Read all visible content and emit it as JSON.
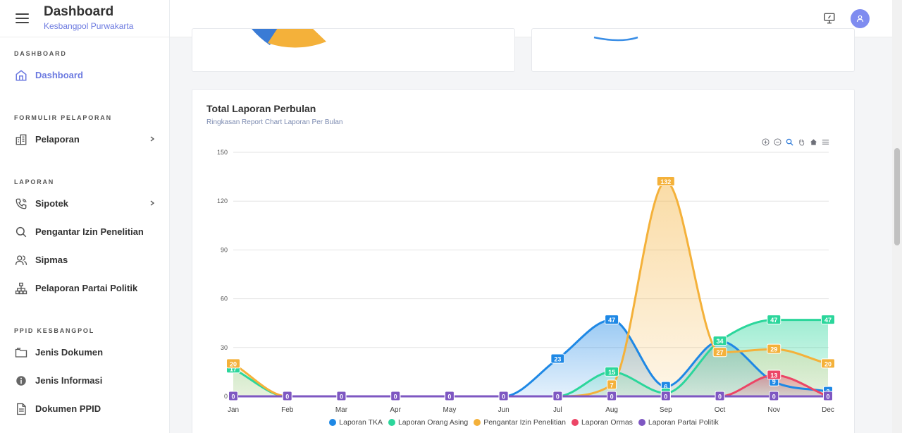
{
  "header": {
    "title": "Dashboard",
    "subtitle": "Kesbangpol Purwakarta"
  },
  "sidebar": {
    "sections": [
      {
        "title": "DASHBOARD",
        "items": [
          {
            "label": "Dashboard",
            "icon": "home-icon",
            "active": true
          }
        ]
      },
      {
        "title": "FORMULIR PELAPORAN",
        "items": [
          {
            "label": "Pelaporan",
            "icon": "building-icon",
            "chevron": true
          }
        ]
      },
      {
        "title": "LAPORAN",
        "items": [
          {
            "label": "Sipotek",
            "icon": "phone-icon",
            "chevron": true
          },
          {
            "label": "Pengantar Izin Penelitian",
            "icon": "search-icon"
          },
          {
            "label": "Sipmas",
            "icon": "users-icon"
          },
          {
            "label": "Pelaporan Partai Politik",
            "icon": "sitemap-icon"
          }
        ]
      },
      {
        "title": "PPID KESBANGPOL",
        "items": [
          {
            "label": "Jenis Dokumen",
            "icon": "folder-icon"
          },
          {
            "label": "Jenis Informasi",
            "icon": "info-icon"
          },
          {
            "label": "Dokumen PPID",
            "icon": "document-icon"
          }
        ]
      }
    ]
  },
  "colors": {
    "accent": "#6c7ae0",
    "tka": "#1E88E5",
    "asing": "#2BD69B",
    "izin": "#F4B13A",
    "ormas": "#EC4566",
    "partai": "#7E57C2"
  },
  "chart_data": {
    "type": "area",
    "title": "Total Laporan Perbulan",
    "subtitle": "Ringkasan Report Chart Laporan Per Bulan",
    "categories": [
      "Jan",
      "Feb",
      "Mar",
      "Apr",
      "May",
      "Jun",
      "Jul",
      "Aug",
      "Sep",
      "Oct",
      "Nov",
      "Dec"
    ],
    "ylim": [
      0,
      150
    ],
    "yticks": [
      0,
      30,
      60,
      90,
      120,
      150
    ],
    "grid": true,
    "legend_position": "bottom",
    "series": [
      {
        "name": "Laporan TKA",
        "color": "#1E88E5",
        "values": [
          0,
          0,
          0,
          0,
          0,
          0,
          23,
          47,
          6,
          34,
          9,
          3
        ]
      },
      {
        "name": "Laporan Orang Asing",
        "color": "#2BD69B",
        "values": [
          17,
          0,
          0,
          0,
          0,
          0,
          0,
          15,
          2,
          34,
          47,
          47
        ]
      },
      {
        "name": "Pengantar Izin Penelitian",
        "color": "#F4B13A",
        "values": [
          20,
          0,
          0,
          0,
          0,
          0,
          0,
          7,
          132,
          27,
          29,
          20
        ]
      },
      {
        "name": "Laporan Ormas",
        "color": "#EC4566",
        "values": [
          0,
          0,
          0,
          0,
          0,
          0,
          0,
          0,
          0,
          0,
          13,
          0
        ]
      },
      {
        "name": "Laporan Partai Politik",
        "color": "#7E57C2",
        "values": [
          0,
          0,
          0,
          0,
          0,
          0,
          0,
          0,
          0,
          0,
          0,
          0
        ]
      }
    ]
  }
}
